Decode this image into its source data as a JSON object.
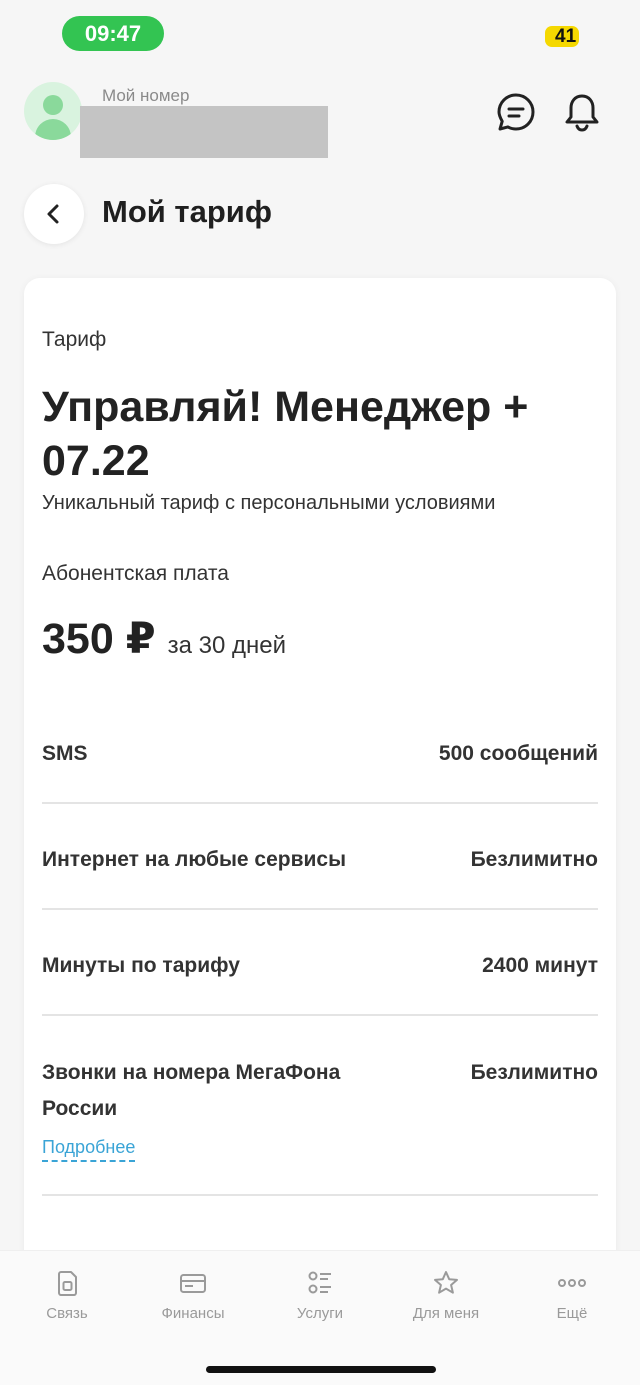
{
  "status_bar": {
    "time": "09:47",
    "battery": "41"
  },
  "header": {
    "my_number_label": "Мой номер"
  },
  "page_title": "Мой тариф",
  "tariff": {
    "label": "Тариф",
    "name": "Управляй! Менеджер + 07.22",
    "description": "Уникальный тариф с персональными условиями",
    "fee_label": "Абонентская плата",
    "fee_amount": "350 ₽",
    "fee_period": "за 30 дней"
  },
  "features": [
    {
      "label": "SMS",
      "value": "500 сообщений"
    },
    {
      "label": "Интернет на любые сервисы",
      "value": "Безлимитно"
    },
    {
      "label": "Минуты по тарифу",
      "value": "2400 минут"
    },
    {
      "label": "Звонки на номера МегаФона России",
      "value": "Безлимитно",
      "link": "Подробнее"
    }
  ],
  "bottom_nav": [
    {
      "label": "Связь",
      "icon": "sim-card-icon"
    },
    {
      "label": "Финансы",
      "icon": "wallet-icon"
    },
    {
      "label": "Услуги",
      "icon": "services-list-icon"
    },
    {
      "label": "Для меня",
      "icon": "star-icon"
    },
    {
      "label": "Ещё",
      "icon": "more-dots-icon"
    }
  ],
  "colors": {
    "accent": "#33c452",
    "link": "#3aa4d6",
    "battery": "#f5d800"
  }
}
